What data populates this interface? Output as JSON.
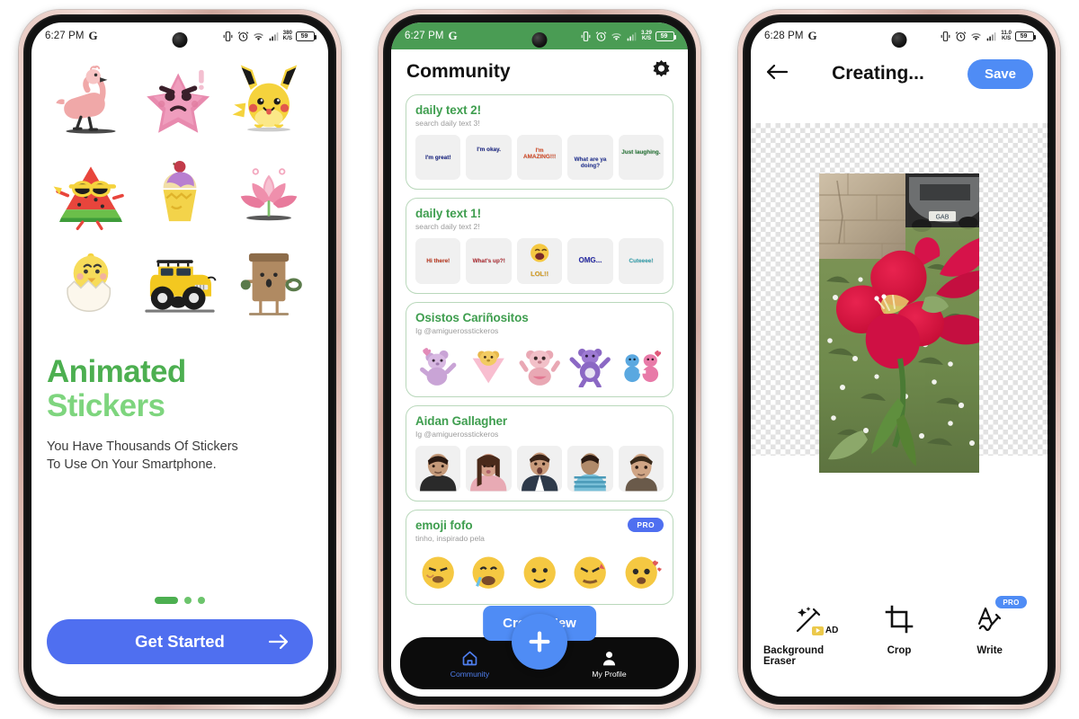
{
  "screens": [
    {
      "id": "onboarding",
      "status": {
        "time": "6:27 PM",
        "brand": "G",
        "speed_value": "380",
        "speed_unit": "K/S",
        "battery": "59"
      },
      "stickers": [
        {
          "name": "flamingo-sticker"
        },
        {
          "name": "angry-star-sticker"
        },
        {
          "name": "pikachu-sticker"
        },
        {
          "name": "watermelon-sticker"
        },
        {
          "name": "ice-cream-sticker"
        },
        {
          "name": "lotus-flower-sticker"
        },
        {
          "name": "hatching-chick-sticker"
        },
        {
          "name": "yellow-jeep-sticker"
        },
        {
          "name": "wood-character-sticker"
        }
      ],
      "title_line1": "Animated",
      "title_line2": "Stickers",
      "subtitle": "You Have Thousands Of Stickers\nTo Use On Your Smartphone.",
      "dots": {
        "count": 3,
        "active_index": 0
      },
      "cta_label": "Get Started",
      "colors": {
        "title_primary": "#4caf50",
        "title_secondary": "#7ed57e",
        "cta": "#4f6ff0"
      }
    },
    {
      "id": "community",
      "status": {
        "time": "6:27 PM",
        "brand": "G",
        "speed_value": "3.29",
        "speed_unit": "K/S",
        "battery": "59",
        "bar_color": "#4a9c54"
      },
      "header": {
        "title": "Community",
        "settings_icon": "gear-icon"
      },
      "packs": [
        {
          "name": "daily text 2!",
          "subtitle": "search daily text 3!",
          "stickers": [
            {
              "text": "I'm great!",
              "color": "#1f2a8a"
            },
            {
              "text": "I'm okay.",
              "color": "#1f2a8a"
            },
            {
              "text": "I'm AMAZING!!!",
              "color": "#d94f2b"
            },
            {
              "text": "What are ya doing?",
              "color": "#2a3a9a"
            },
            {
              "text": "Just laughing.",
              "color": "#2a7a3a"
            }
          ]
        },
        {
          "name": "daily text 1!",
          "subtitle": "search daily text 2!",
          "stickers": [
            {
              "text": "Hi there!",
              "color": "#c23b22"
            },
            {
              "text": "What's up?!",
              "color": "#b5333a"
            },
            {
              "text": "LOL!!",
              "color": "#d8a026"
            },
            {
              "text": "OMG...",
              "color": "#2b2fa8"
            },
            {
              "text": "Cuteeee!",
              "color": "#3aa8b5"
            }
          ]
        },
        {
          "name": "Osistos Cariñositos",
          "subtitle": "Ig @amiguerosstickeros",
          "stickers": [
            {
              "kind": "bear",
              "color": "#c9a4d6"
            },
            {
              "kind": "bear",
              "color": "#e8b84b"
            },
            {
              "kind": "bear",
              "color": "#e9a8b4"
            },
            {
              "kind": "bear",
              "color": "#8b68c4"
            },
            {
              "kind": "bear",
              "color": "#5aa8e0"
            }
          ]
        },
        {
          "name": "Aidan Gallagher",
          "subtitle": "Ig @amiguerosstickeros",
          "stickers": [
            {
              "kind": "photo",
              "color": "#4a3a34"
            },
            {
              "kind": "photo",
              "color": "#d9a0a8"
            },
            {
              "kind": "photo",
              "color": "#3b4556"
            },
            {
              "kind": "photo",
              "color": "#4f8fa8"
            },
            {
              "kind": "photo",
              "color": "#6b5a4a"
            }
          ]
        },
        {
          "name": "emoji fofo",
          "subtitle": "tinho, inspirado pela",
          "badge": "PRO",
          "stickers": [
            {
              "kind": "emoji",
              "color": "#f5c842"
            },
            {
              "kind": "emoji",
              "color": "#f5c842"
            },
            {
              "kind": "emoji",
              "color": "#f5c842"
            },
            {
              "kind": "emoji",
              "color": "#f5c842"
            },
            {
              "kind": "emoji",
              "color": "#f5c842"
            }
          ]
        }
      ],
      "tooltip": "Create New",
      "fab": {
        "icon": "plus-icon"
      },
      "nav": [
        {
          "label": "Community",
          "icon": "home-icon",
          "active": true
        },
        {
          "label": "My Profile",
          "icon": "person-icon",
          "active": false
        }
      ]
    },
    {
      "id": "editor",
      "status": {
        "time": "6:28 PM",
        "brand": "G",
        "speed_value": "11.0",
        "speed_unit": "K/S",
        "battery": "59"
      },
      "header": {
        "back_icon": "arrow-left-icon",
        "title": "Creating...",
        "save_label": "Save"
      },
      "photo_alt": "red-amaryllis-flower-photo",
      "tools": [
        {
          "label": "Background Eraser",
          "icon": "magic-wand-icon",
          "badge": "AD"
        },
        {
          "label": "Crop",
          "icon": "crop-icon",
          "badge": ""
        },
        {
          "label": "Write",
          "icon": "write-pen-icon",
          "badge": "PRO"
        }
      ]
    }
  ]
}
